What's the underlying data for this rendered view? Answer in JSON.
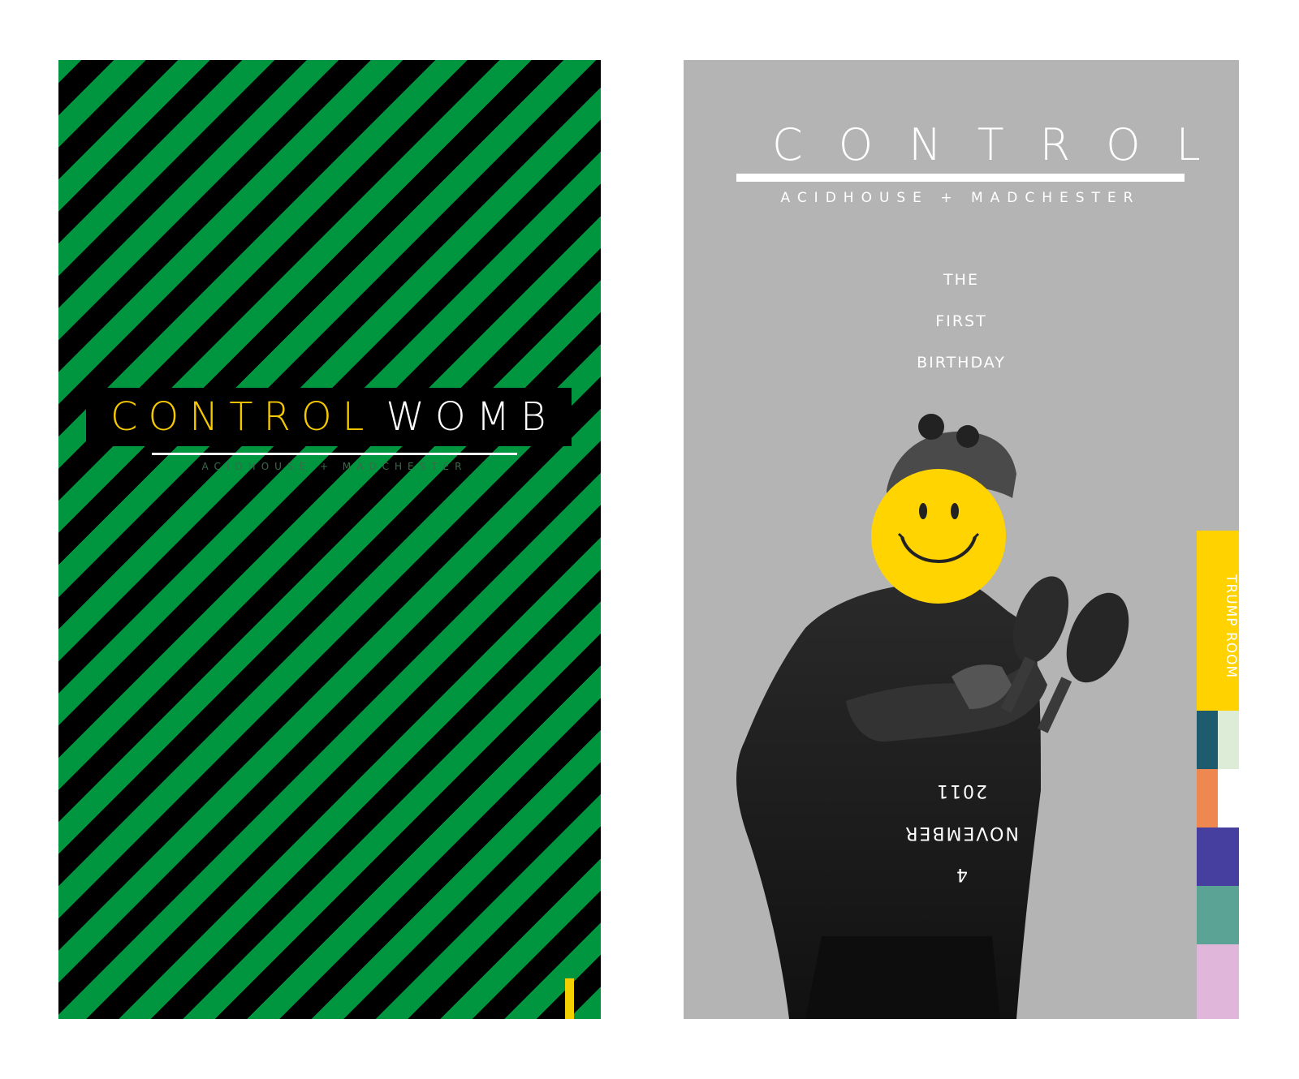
{
  "left_poster": {
    "title_part1": "CONTROL",
    "title_part2": "WOMB",
    "subtitle": "ACIDHOUSE + MADCHESTER",
    "colors": {
      "stripe_green": "#009640",
      "stripe_black": "#000000",
      "title_yellow": "#f5c800"
    }
  },
  "right_poster": {
    "title": "CONTROL",
    "subtitle": "ACIDHOUSE + MADCHESTER",
    "lines": [
      "THE",
      "FIRST",
      "BIRTHDAY"
    ],
    "date_year": "2011",
    "date_month": "NOVEMBER",
    "date_day": "4",
    "venue": "TRUMP ROOM",
    "smiley": "smiley-face-icon",
    "colors": {
      "background": "#b4b4b4",
      "tab_yellow": "#ffd200",
      "swatches": [
        "#1f5b6e",
        "#dcecd6",
        "#ee8750",
        "#ffffff",
        "#473fa0",
        "#5ba395",
        "#e0b6da"
      ]
    }
  }
}
